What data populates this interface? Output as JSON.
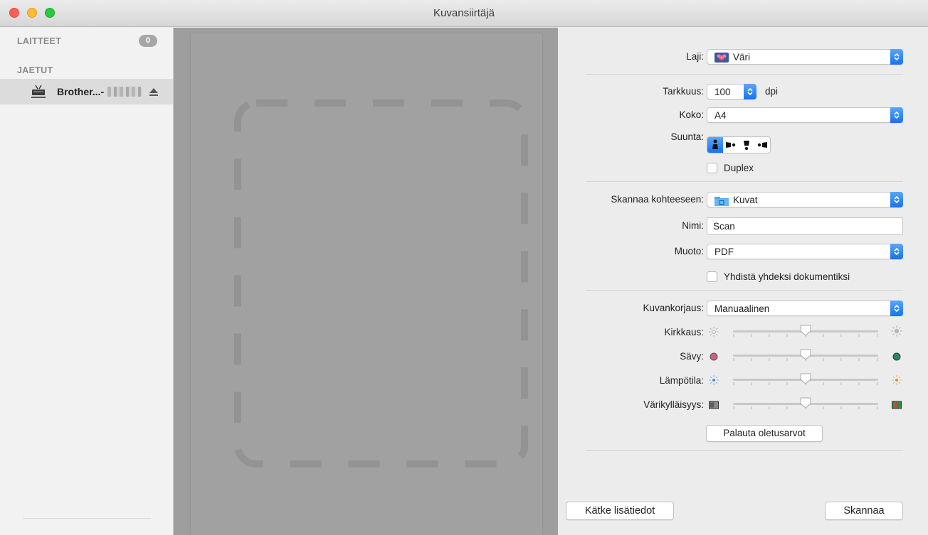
{
  "window": {
    "title": "Kuvansiirtäjä"
  },
  "sidebar": {
    "devices_heading": "LAITTEET",
    "devices_count": "0",
    "shared_heading": "JAETUT",
    "shared_device_name": "Brother...-"
  },
  "settings": {
    "kind": {
      "label": "Laji:",
      "value": "Väri"
    },
    "resolution": {
      "label": "Tarkkuus:",
      "value": "100",
      "unit": "dpi"
    },
    "size": {
      "label": "Koko:",
      "value": "A4"
    },
    "orientation": {
      "label": "Suunta:",
      "selected_index": 0
    },
    "duplex": {
      "label": "Duplex",
      "checked": false
    },
    "scan_to": {
      "label": "Skannaa kohteeseen:",
      "value": "Kuvat"
    },
    "name": {
      "label": "Nimi:",
      "value": "Scan"
    },
    "format": {
      "label": "Muoto:",
      "value": "PDF"
    },
    "combine": {
      "label": "Yhdistä yhdeksi dokumentiksi",
      "checked": false
    },
    "image_correction": {
      "label": "Kuvankorjaus:",
      "value": "Manuaalinen"
    },
    "brightness": {
      "label": "Kirkkaus:",
      "position": 0.5
    },
    "tint": {
      "label": "Sävy:",
      "position": 0.5
    },
    "temperature": {
      "label": "Lämpötila:",
      "position": 0.5
    },
    "saturation": {
      "label": "Värikylläisyys:",
      "position": 0.5
    },
    "reset_button": "Palauta oletusarvot"
  },
  "footer": {
    "hide_details_button": "Kätke lisätiedot",
    "scan_button": "Skannaa"
  },
  "colors": {
    "accent": "#1772f0",
    "tint_left": "#d15f7e",
    "tint_right": "#1f8a66"
  }
}
